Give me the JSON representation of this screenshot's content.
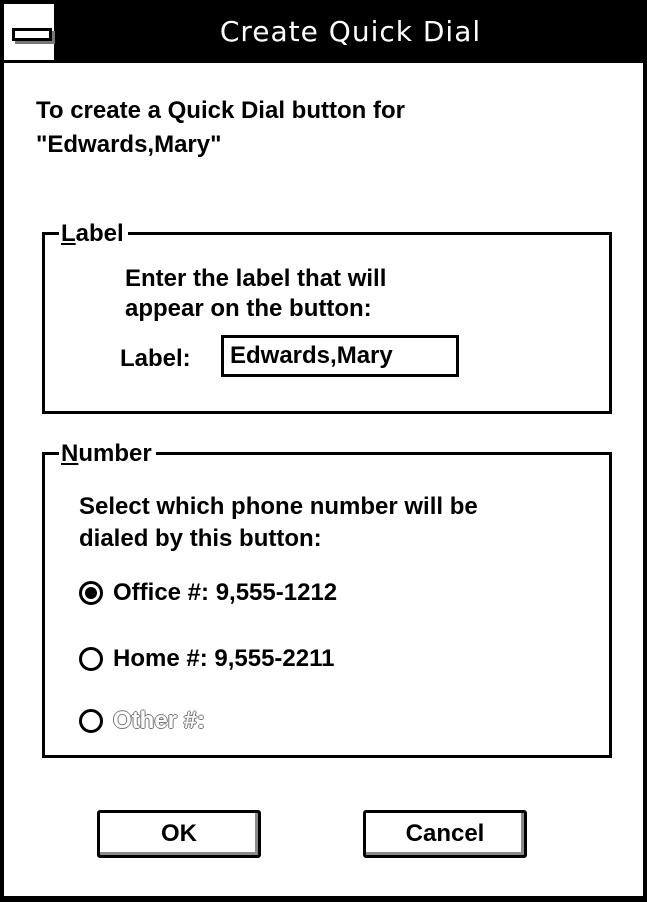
{
  "window": {
    "title": "Create Quick Dial"
  },
  "intro": {
    "line1": "To create a Quick Dial button for",
    "line2": "\"Edwards,Mary\""
  },
  "label_group": {
    "legend_mnemonic": "L",
    "legend_rest": "abel",
    "description_line1": "Enter the label that will",
    "description_line2": "appear on the button:",
    "field_label": "Label:",
    "field_value": "Edwards,Mary"
  },
  "number_group": {
    "legend_mnemonic": "N",
    "legend_rest": "umber",
    "description_line1": "Select which phone number will be",
    "description_line2": "dialed by this button:",
    "options": [
      {
        "label": "Office #: 9,555-1212",
        "checked": true,
        "disabled": false
      },
      {
        "label": "Home #: 9,555-2211",
        "checked": false,
        "disabled": false
      },
      {
        "label": "Other #:",
        "checked": false,
        "disabled": true
      }
    ]
  },
  "buttons": {
    "ok": "OK",
    "cancel": "Cancel"
  }
}
